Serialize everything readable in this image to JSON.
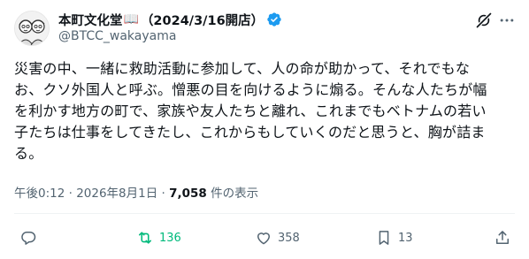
{
  "tweet": {
    "display_name": "本町文化堂",
    "name_emoji": "📖",
    "name_suffix": "（2024/3/16開店）",
    "handle": "@BTCC_wakayama",
    "body_lines": [
      "災害の中、一緒に救助活動に参加して、人の命が助かって、それでもな",
      "お、クソ外国人と呼ぶ。憎悪の目を向けるように煽る。そんな人たちが幅",
      "を利かす地方の町で、家族や友人たちと離れ、これまでもベトナムの若い",
      "子たちは仕事をしてきたし、これからもしていくのだと思うと、胸が詰ま",
      "る。"
    ],
    "timestamp": "午後0:12 · 2026年8月1日 · ",
    "views_count": "7,058",
    "views_label": " 件の表示"
  },
  "actions": {
    "reply_count": "",
    "retweet_count": "136",
    "like_count": "358",
    "bookmark_count": "13"
  },
  "icons": {
    "verified": "verified-badge-icon",
    "grok": "grok-icon",
    "more": "more-icon",
    "reply": "reply-icon",
    "retweet": "retweet-icon",
    "like": "like-icon",
    "bookmark": "bookmark-icon",
    "share": "share-icon"
  },
  "colors": {
    "verified_blue": "#1d9bf0",
    "retweet_green": "#00ba7c",
    "secondary_text": "#536471"
  }
}
